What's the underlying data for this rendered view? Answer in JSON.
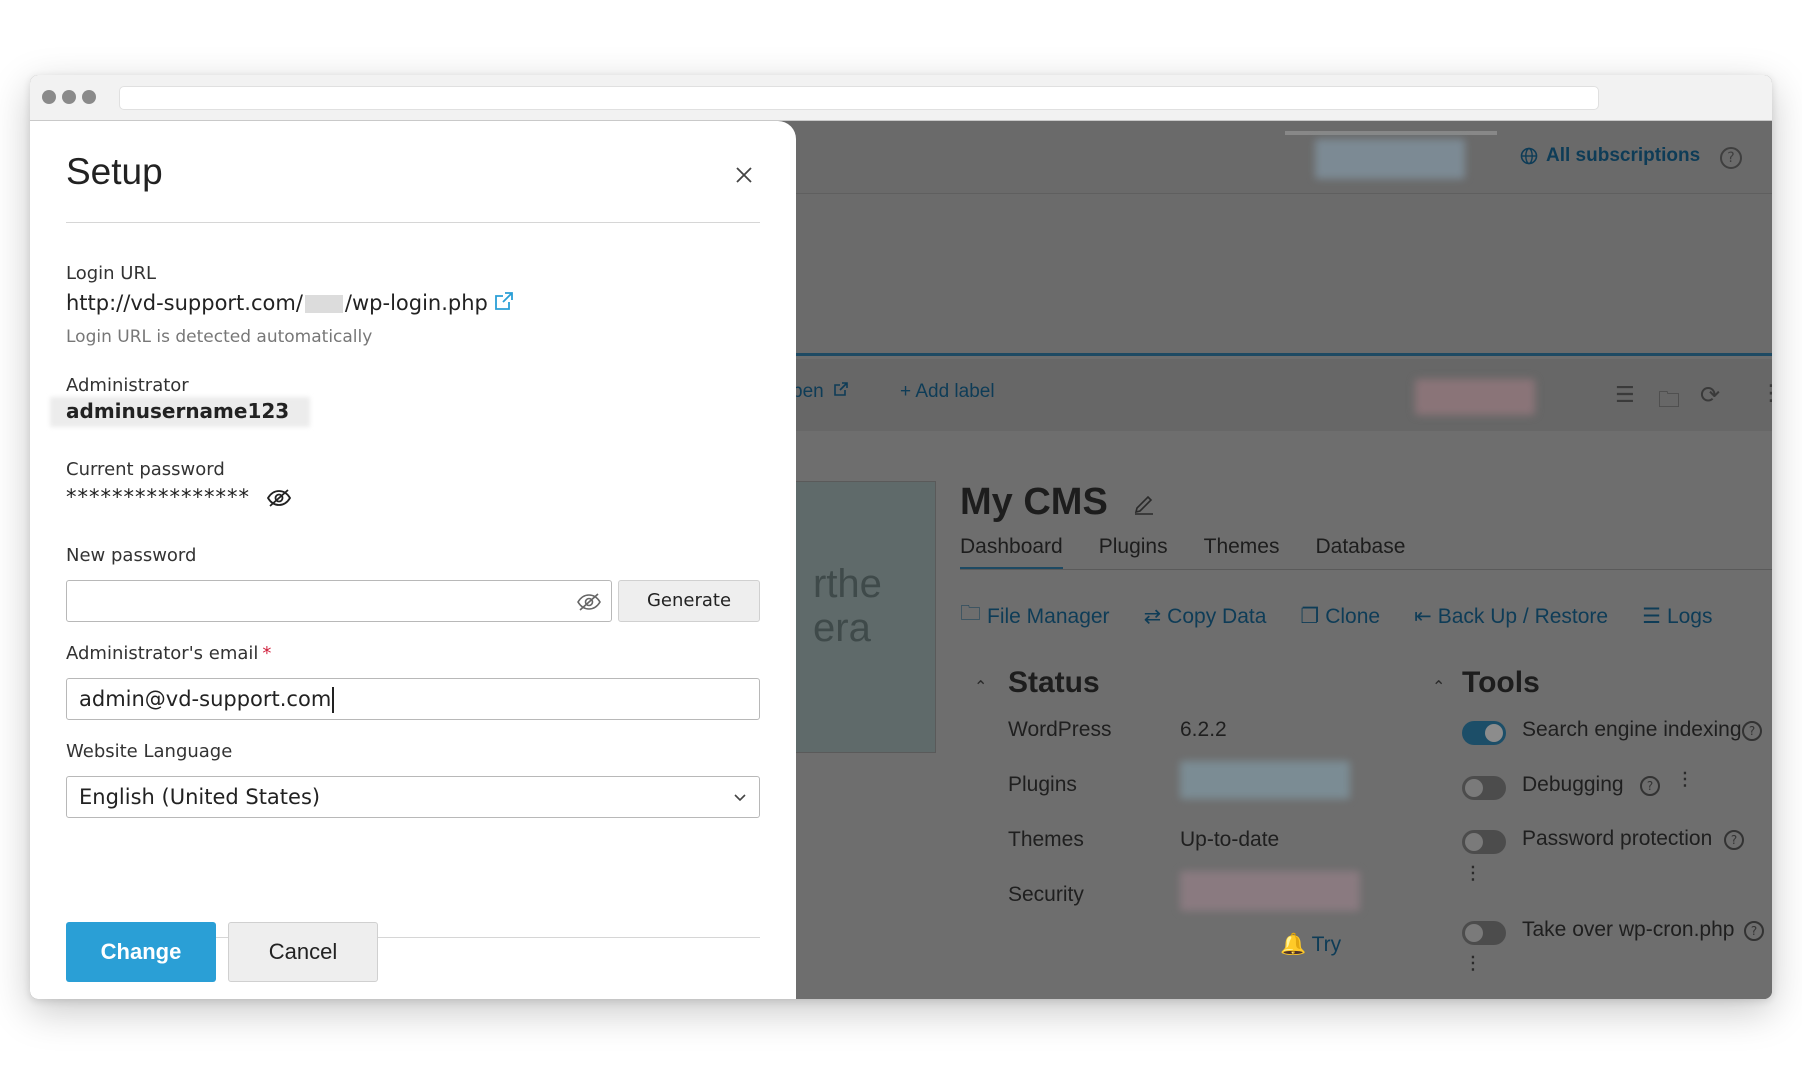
{
  "background": {
    "top_link": "All subscriptions",
    "toolbar": {
      "open_partial": "pen",
      "add_label": "Add label"
    },
    "thumbnail_text": [
      "rthe",
      "era"
    ],
    "site_title": "My CMS",
    "tabs": [
      "Dashboard",
      "Plugins",
      "Themes",
      "Database"
    ],
    "actions": [
      "File Manager",
      "Copy Data",
      "Clone",
      "Back Up / Restore",
      "Logs"
    ],
    "status": {
      "heading": "Status",
      "rows": [
        {
          "label": "WordPress",
          "value": "6.2.2"
        },
        {
          "label": "Plugins",
          "value": ""
        },
        {
          "label": "Themes",
          "value": "Up-to-date"
        },
        {
          "label": "Security",
          "value": ""
        }
      ],
      "try_link": "Try"
    },
    "tools": {
      "heading": "Tools",
      "items": [
        {
          "label": "Search engine indexing",
          "on": true
        },
        {
          "label": "Debugging",
          "on": false
        },
        {
          "label": "Password protection",
          "on": false
        },
        {
          "label": "Take over wp-cron.php",
          "on": false
        }
      ]
    }
  },
  "modal": {
    "title": "Setup",
    "login_url": {
      "label": "Login URL",
      "prefix": "http://vd-support.com/",
      "suffix": "/wp-login.php",
      "hint": "Login URL is detected automatically"
    },
    "administrator": {
      "label": "Administrator",
      "value": "adminusername123"
    },
    "current_password": {
      "label": "Current password",
      "value": "****************"
    },
    "new_password": {
      "label": "New password",
      "value": "",
      "generate_label": "Generate"
    },
    "admin_email": {
      "label": "Administrator's email",
      "required_mark": "*",
      "value": "admin@vd-support.com"
    },
    "language": {
      "label": "Website Language",
      "selected": "English (United States)"
    },
    "buttons": {
      "change": "Change",
      "cancel": "Cancel"
    }
  },
  "colors": {
    "primary": "#2a9fd6",
    "link": "#0e3c57",
    "required": "#d0203c"
  }
}
